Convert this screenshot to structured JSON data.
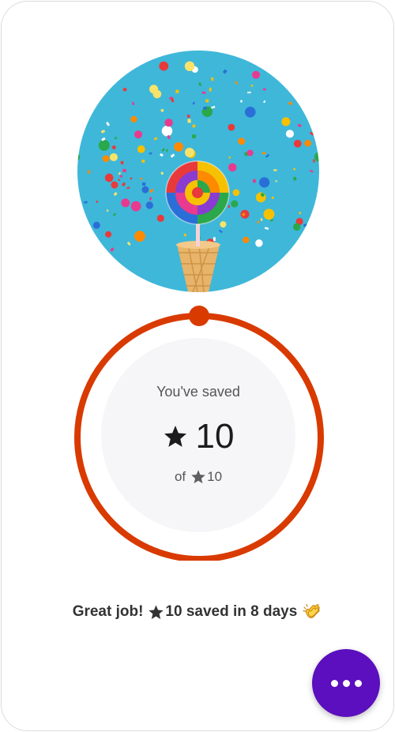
{
  "savings": {
    "saved_label": "You've saved",
    "saved_value": "10",
    "goal_prefix": "of",
    "goal_value": "10",
    "progress_fraction": 1.0,
    "currency_icon": "star-icon"
  },
  "message": {
    "part1": "Great job!",
    "part2": "10 saved in 8 days",
    "emoji_icon": "clapping-hands-icon"
  },
  "fab": {
    "icon": "more-dots-icon"
  },
  "colors": {
    "ring": "#d93a00",
    "panel": "#f6f6f8",
    "fab": "#5b0fbe",
    "hero_background": "#3fb7d9"
  }
}
